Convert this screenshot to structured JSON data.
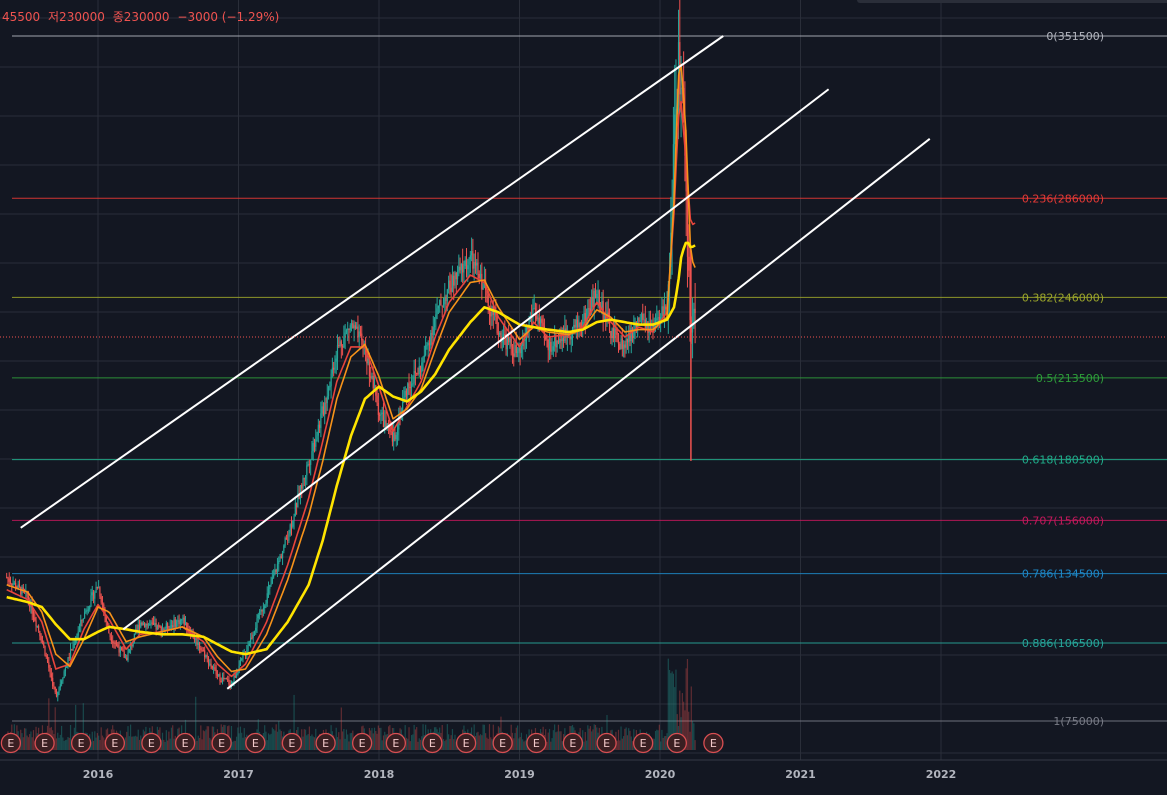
{
  "header": {
    "high_fragment": "45500",
    "low": "저230000",
    "close": "종230000",
    "change": "−3000 (−1.29%)"
  },
  "colors": {
    "background": "#131722",
    "grid": "#2a2e39",
    "candle_up": "#26a69a",
    "candle_down": "#ef5350",
    "ma_short": "#e8453c",
    "ma_mid": "#f7931a",
    "ma_long": "#ffe400",
    "channel": "#ffffff",
    "axis_text": "#b2b5be"
  },
  "chart_data": {
    "type": "candlestick",
    "title": "",
    "xlabel": "",
    "ylabel": "",
    "x_ticks": [
      "2016",
      "2017",
      "2018",
      "2019",
      "2020",
      "2021",
      "2022"
    ],
    "x_range": [
      2015.35,
      2022.9
    ],
    "price_range": [
      75000,
      351500
    ],
    "fibonacci_levels": [
      {
        "level": "0",
        "price": 351500,
        "label": "0(351500)",
        "color": "#b2b5be"
      },
      {
        "level": "0.236",
        "price": 286000,
        "label": "0.236(286000)",
        "color": "#e53935"
      },
      {
        "level": "0.382",
        "price": 246000,
        "label": "0.382(246000)",
        "color": "#9ba52a"
      },
      {
        "level": "0.5",
        "price": 213500,
        "label": "0.5(213500)",
        "color": "#2e9e3a"
      },
      {
        "level": "0.618",
        "price": 180500,
        "label": "0.618(180500)",
        "color": "#1fae8b"
      },
      {
        "level": "0.707",
        "price": 156000,
        "label": "0.707(156000)",
        "color": "#c2185b"
      },
      {
        "level": "0.786",
        "price": 134500,
        "label": "0.786(134500)",
        "color": "#1e88c7"
      },
      {
        "level": "0.886",
        "price": 106500,
        "label": "0.886(106500)",
        "color": "#26a69a"
      },
      {
        "level": "1",
        "price": 75000,
        "label": "1(75000)",
        "color": "#787b86"
      }
    ],
    "current_price": 230000,
    "price_series": {
      "x": [
        2015.35,
        2015.5,
        2015.6,
        2015.7,
        2015.8,
        2015.9,
        2016.0,
        2016.08,
        2016.2,
        2016.3,
        2016.45,
        2016.6,
        2016.75,
        2016.85,
        2016.95,
        2017.05,
        2017.2,
        2017.35,
        2017.5,
        2017.6,
        2017.7,
        2017.8,
        2017.9,
        2018.0,
        2018.1,
        2018.2,
        2018.3,
        2018.4,
        2018.5,
        2018.65,
        2018.75,
        2018.85,
        2019.0,
        2019.1,
        2019.2,
        2019.35,
        2019.45,
        2019.55,
        2019.65,
        2019.75,
        2019.85,
        2019.95,
        2020.05,
        2020.1,
        2020.13,
        2020.15,
        2020.18,
        2020.2,
        2020.22,
        2020.25
      ],
      "close": [
        133000,
        125000,
        108000,
        85000,
        102000,
        118000,
        130000,
        110000,
        100000,
        115000,
        112000,
        116000,
        103000,
        93000,
        90000,
        103000,
        125000,
        150000,
        180000,
        200000,
        225000,
        235000,
        225000,
        200000,
        188000,
        210000,
        218000,
        238000,
        250000,
        262000,
        250000,
        232000,
        222000,
        242000,
        226000,
        232000,
        236000,
        248000,
        232000,
        226000,
        237000,
        232000,
        244000,
        305000,
        340000,
        335000,
        300000,
        262000,
        232000,
        235000
      ]
    },
    "moving_averages": [
      {
        "color": "#e8453c",
        "values": [
          128000,
          124000,
          115000,
          96000,
          98000,
          112000,
          122000,
          116000,
          104000,
          110000,
          111000,
          113000,
          107000,
          98000,
          93000,
          98000,
          115000,
          138000,
          165000,
          188000,
          212000,
          226000,
          226000,
          210000,
          192000,
          202000,
          212000,
          230000,
          244000,
          255000,
          252000,
          238000,
          226000,
          236000,
          230000,
          231000,
          234000,
          244000,
          236000,
          230000,
          234000,
          232000,
          240000,
          280000,
          318000,
          325000,
          305000,
          290000,
          275000,
          276000
        ]
      },
      {
        "color": "#f7931a",
        "values": [
          130000,
          127000,
          119000,
          102000,
          97000,
          108000,
          121000,
          119000,
          107000,
          109000,
          111000,
          113000,
          109000,
          101000,
          95000,
          96000,
          110000,
          132000,
          158000,
          180000,
          205000,
          222000,
          227000,
          214000,
          197000,
          201000,
          209000,
          225000,
          240000,
          252000,
          253000,
          242000,
          229000,
          234000,
          232000,
          231000,
          233000,
          241000,
          238000,
          232000,
          233000,
          233000,
          238000,
          285000,
          335000,
          340000,
          318000,
          290000,
          262000,
          258000
        ]
      },
      {
        "color": "#ffe400",
        "values": [
          125000,
          123000,
          121000,
          114000,
          108000,
          108000,
          111000,
          113000,
          112000,
          111000,
          110000,
          110000,
          109000,
          106000,
          103000,
          102000,
          104000,
          115000,
          130000,
          148000,
          170000,
          190000,
          205000,
          210000,
          206000,
          204000,
          208000,
          215000,
          225000,
          236000,
          242000,
          240000,
          235000,
          234000,
          233000,
          232000,
          233000,
          236000,
          237000,
          236000,
          235000,
          235000,
          237000,
          242000,
          252000,
          262000,
          268000,
          268000,
          266000,
          267000
        ]
      }
    ],
    "channel_lines": [
      {
        "x": [
          2015.45,
          2020.45
        ],
        "y": [
          153000,
          351500
        ]
      },
      {
        "x": [
          2016.18,
          2021.2
        ],
        "y": [
          112000,
          330000
        ]
      },
      {
        "x": [
          2016.92,
          2021.92
        ],
        "y": [
          88000,
          310000
        ]
      }
    ],
    "earnings_markers": {
      "label": "E",
      "x": [
        2015.38,
        2015.62,
        2015.88,
        2016.12,
        2016.38,
        2016.62,
        2016.88,
        2017.12,
        2017.38,
        2017.62,
        2017.88,
        2018.12,
        2018.38,
        2018.62,
        2018.88,
        2019.12,
        2019.38,
        2019.62,
        2019.88,
        2020.12,
        2020.38
      ]
    }
  }
}
